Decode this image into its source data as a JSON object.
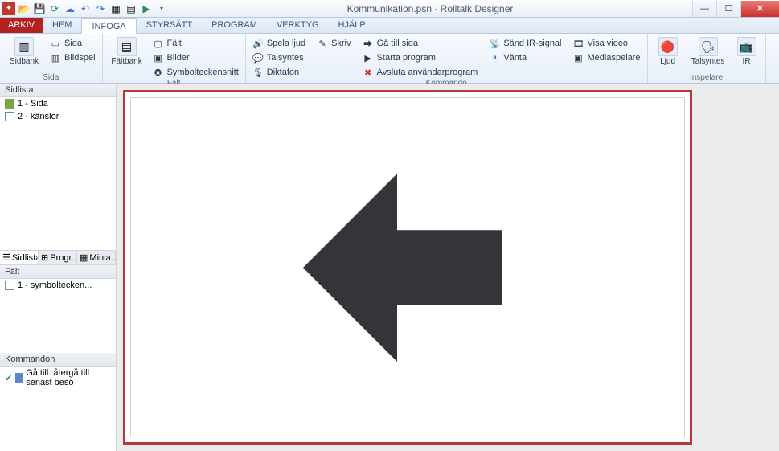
{
  "title": "Kommunikation.psn - Rolltalk Designer",
  "qat_icons": [
    "app",
    "open",
    "refresh",
    "cloud",
    "undo",
    "redo",
    "tool1",
    "tool2",
    "play"
  ],
  "tabs": {
    "file": "ARKIV",
    "items": [
      "HEM",
      "INFOGA",
      "STYRSÄTT",
      "PROGRAM",
      "VERKTYG",
      "HJÄLP"
    ],
    "active": "INFOGA"
  },
  "ribbon": {
    "groups": [
      {
        "name": "Sida",
        "big": {
          "label": "Sidbank"
        },
        "small": [
          "Sida",
          "Bildspel"
        ]
      },
      {
        "name": "Fält",
        "big": {
          "label": "Fältbank"
        },
        "small": [
          "Fält",
          "Bilder",
          "Symbolteckensnitt"
        ]
      },
      {
        "name": "Kommando",
        "cols": [
          [
            "Spela ljud",
            "Talsyntes",
            "Diktafon"
          ],
          [
            "Skriv"
          ],
          [
            "Gå till sida",
            "Starta program",
            "Avsluta användarprogram"
          ],
          [
            "Sänd IR-signal",
            "Vänta"
          ],
          [
            "Visa video",
            "Mediaspelare"
          ]
        ]
      },
      {
        "name": "Inspelare",
        "bigs": [
          "Ljud",
          "Talsyntes",
          "IR"
        ]
      }
    ]
  },
  "side": {
    "sidlista_hdr": "Sidlista",
    "pages": [
      {
        "label": "1 - Sida",
        "color": "green"
      },
      {
        "label": "2 - känslor",
        "color": "blue"
      }
    ],
    "tabs": [
      "Sidlista",
      "Progr...",
      "Minia..."
    ],
    "falt_hdr": "Fält",
    "falt_items": [
      {
        "label": "1 - symboltecken..."
      }
    ],
    "kommandon_hdr": "Kommandon",
    "kommandon_items": [
      {
        "label": "Gå till: återgå till senast besö"
      }
    ]
  }
}
